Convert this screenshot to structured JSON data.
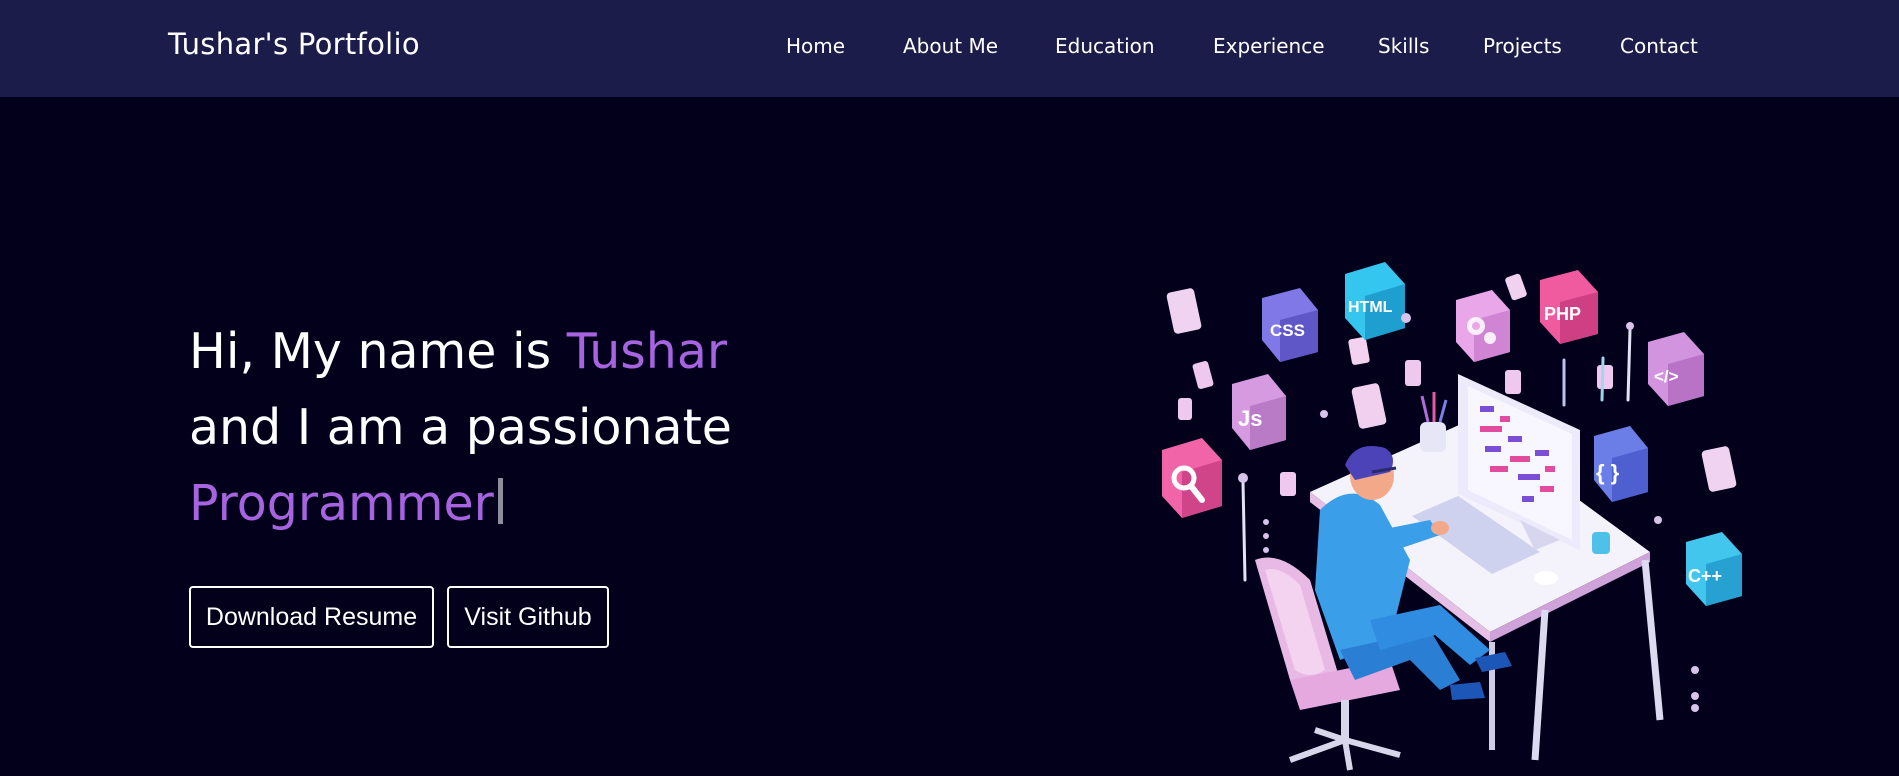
{
  "header": {
    "brand": "Tushar's Portfolio",
    "nav": [
      "Home",
      "About Me",
      "Education",
      "Experience",
      "Skills",
      "Projects",
      "Contact"
    ]
  },
  "hero": {
    "line1_prefix": "Hi, My name is ",
    "name": "Tushar",
    "line2": "and I am a passionate",
    "role": "Programmer"
  },
  "buttons": {
    "resume": "Download Resume",
    "github": "Visit Github"
  },
  "illustration": {
    "tiles": {
      "css": "CSS",
      "html": "HTML",
      "php": "PHP",
      "js": "Js",
      "code": "</>",
      "braces": "{ }",
      "cpp": "C++"
    }
  },
  "colors": {
    "background": "#03001c",
    "navbar": "#1c1c4a",
    "accent": "#a764e0",
    "text": "#ffffff"
  }
}
